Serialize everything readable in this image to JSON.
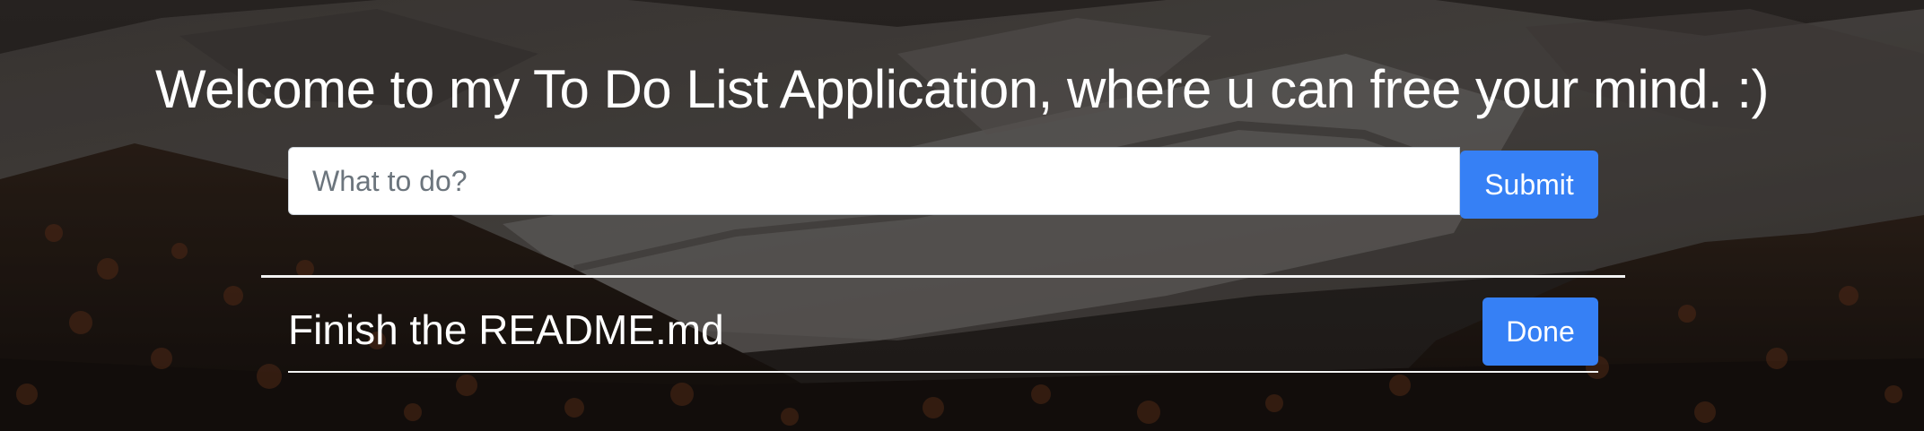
{
  "header": {
    "title": "Welcome to my To Do List Application, where u can free your mind. :)"
  },
  "form": {
    "input_value": "",
    "input_placeholder": "What to do?",
    "submit_label": "Submit"
  },
  "todos": [
    {
      "text": "Finish the README.md",
      "action_label": "Done"
    }
  ],
  "colors": {
    "primary_button": "#3680f5",
    "text": "#ffffff",
    "input_background": "#ffffff"
  }
}
